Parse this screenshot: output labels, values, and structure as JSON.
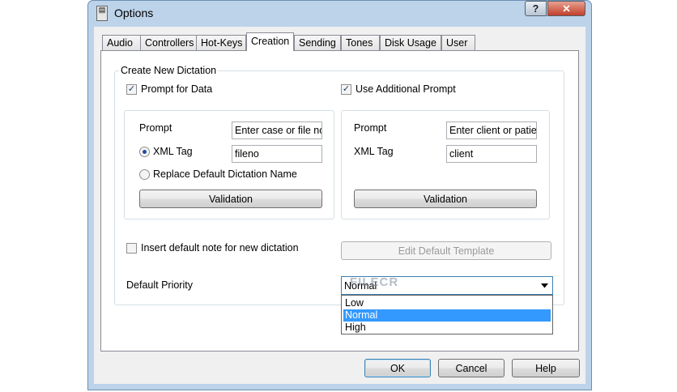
{
  "window": {
    "title": "Options",
    "help_glyph": "?",
    "close_glyph": "✕",
    "app_icon_glyph": "▤"
  },
  "tabs": [
    {
      "label": "Audio"
    },
    {
      "label": "Controllers"
    },
    {
      "label": "Hot-Keys"
    },
    {
      "label": "Creation",
      "active": true
    },
    {
      "label": "Sending"
    },
    {
      "label": "Tones"
    },
    {
      "label": "Disk Usage"
    },
    {
      "label": "User"
    }
  ],
  "create_new_dictation": {
    "legend": "Create New Dictation",
    "prompt_for_data": {
      "label": "Prompt for Data",
      "checked": true
    },
    "use_additional_prompt": {
      "label": "Use Additional Prompt",
      "checked": true
    },
    "left_box": {
      "prompt_label": "Prompt",
      "prompt_value": "Enter case or file no",
      "xml_tag_label": "XML Tag",
      "xml_tag_value": "fileno",
      "xml_tag_selected": true,
      "replace_label": "Replace Default Dictation Name",
      "validation_label": "Validation"
    },
    "right_box": {
      "prompt_label": "Prompt",
      "prompt_value": "Enter client or patier",
      "xml_tag_label": "XML Tag",
      "xml_tag_value": "client",
      "validation_label": "Validation"
    },
    "insert_default_note": {
      "label": "Insert default note for new dictation",
      "checked": false
    },
    "edit_template_label": "Edit Default Template",
    "priority_label": "Default Priority",
    "priority_value": "Normal",
    "priority_options": [
      "Low",
      "Normal",
      "High"
    ],
    "priority_selected": "Normal"
  },
  "watermark": "FILECR",
  "footer": {
    "ok_label": "OK",
    "cancel_label": "Cancel",
    "help_label": "Help"
  },
  "colors": {
    "selection": "#3399ff",
    "frame": "#bcd3ea"
  }
}
